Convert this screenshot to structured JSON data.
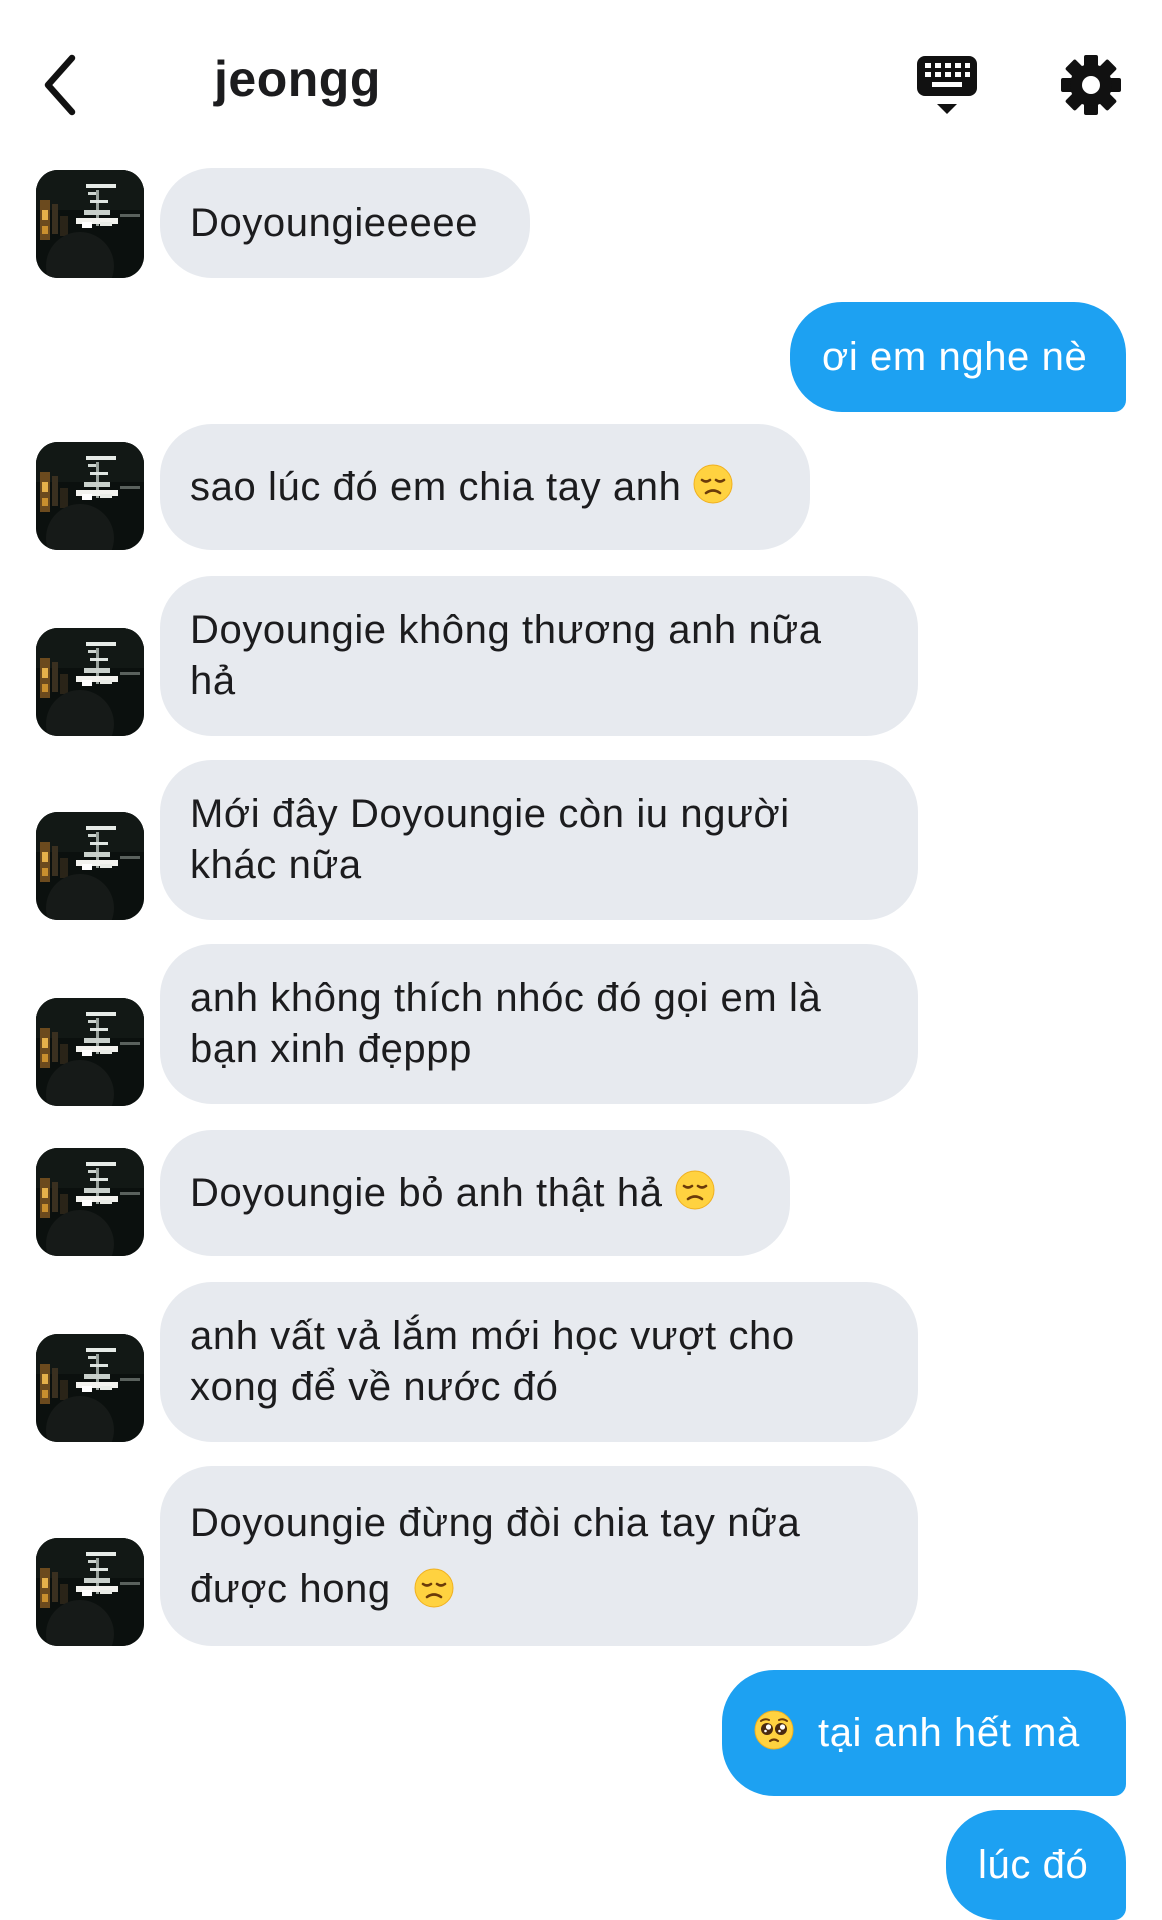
{
  "header": {
    "title": "jeongg",
    "icons": [
      "back-arrow-icon",
      "keyboard-icon",
      "gear-icon"
    ]
  },
  "messages": [
    {
      "dir": "in",
      "text": "Doyoungieeeee"
    },
    {
      "dir": "out",
      "text": "ơi em nghe nè"
    },
    {
      "dir": "in",
      "text": "sao lúc đó em chia tay anh",
      "emoji": "disappointed-face-emoji"
    },
    {
      "dir": "in",
      "line1": "Doyoungie không thương anh nữa",
      "line2": "hả"
    },
    {
      "dir": "in",
      "line1": "Mới đây Doyoungie còn iu người",
      "line2": "khác nữa"
    },
    {
      "dir": "in",
      "line1": "anh không thích nhóc đó gọi em là",
      "line2": "bạn xinh đẹppp"
    },
    {
      "dir": "in",
      "text": "Doyoungie bỏ anh thật hả",
      "emoji": "disappointed-face-emoji"
    },
    {
      "dir": "in",
      "line1": "anh vất vả lắm mới học vượt cho",
      "line2": "xong để về nước đó"
    },
    {
      "dir": "in",
      "line1": "Doyoungie đừng đòi chia tay nữa",
      "line2": "được hong",
      "emoji": "disappointed-face-emoji"
    },
    {
      "dir": "out",
      "text": "tại anh hết mà",
      "emoji": "pleading-face-emoji"
    },
    {
      "dir": "out",
      "text": "lúc đó"
    }
  ],
  "colors": {
    "incoming_bubble": "#e7eaef",
    "outgoing_bubble": "#1da1f2",
    "outgoing_text": "#ffffff",
    "text": "#1c1c1e"
  }
}
